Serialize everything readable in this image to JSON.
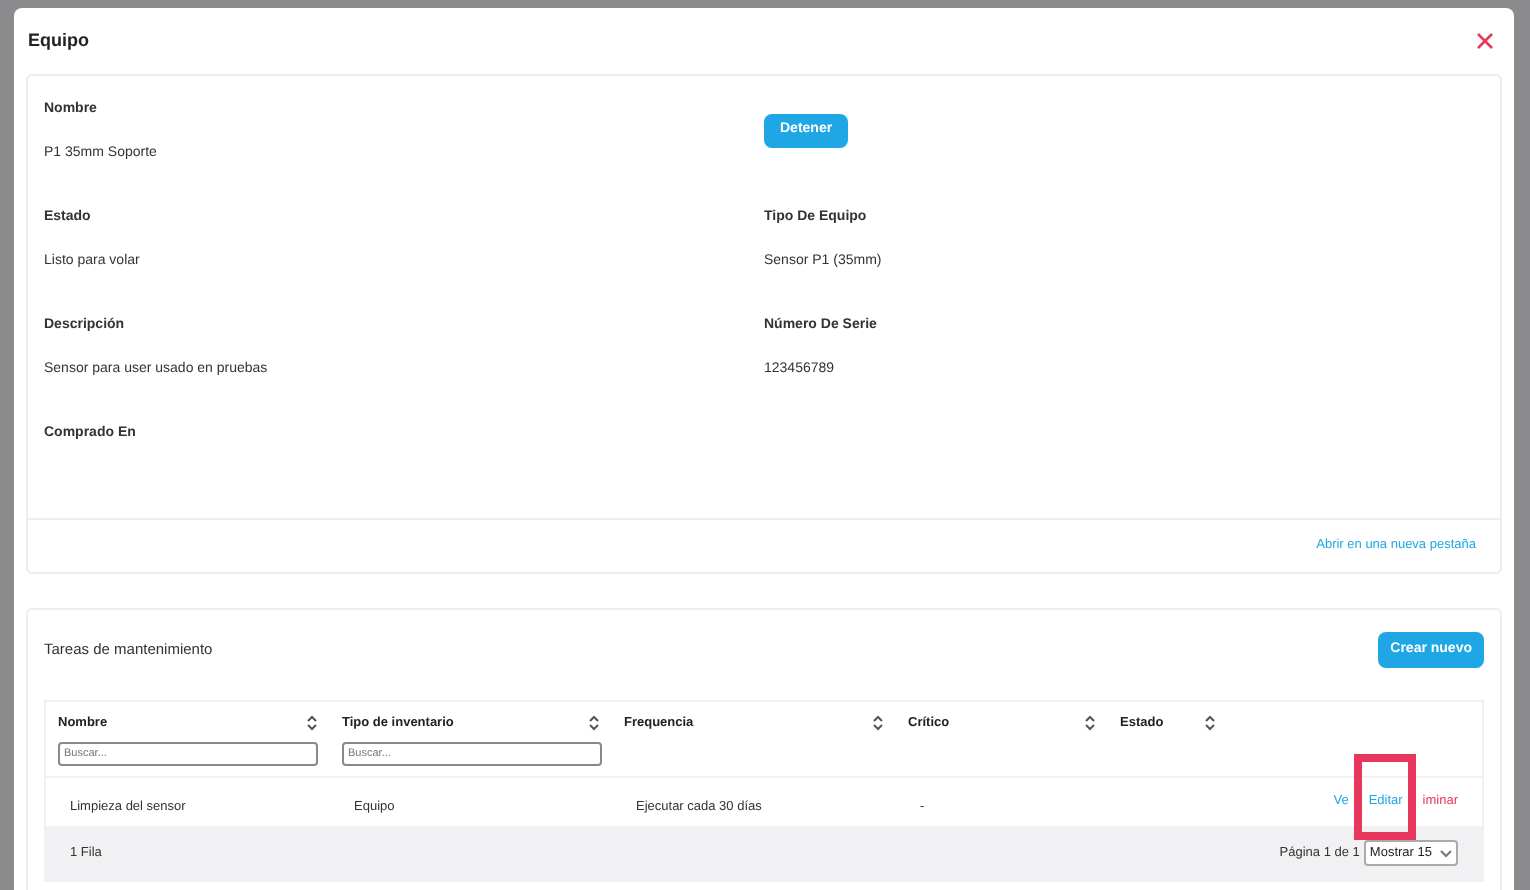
{
  "modal": {
    "title": "Equipo"
  },
  "details": {
    "rows": [
      {
        "cells": [
          {
            "kind": "field",
            "label": "Nombre",
            "value": "P1 35mm Soporte"
          },
          {
            "kind": "button",
            "label": "Detener"
          }
        ]
      },
      {
        "cells": [
          {
            "kind": "field",
            "label": "Estado",
            "value": "Listo para volar"
          },
          {
            "kind": "field",
            "label": "Tipo De Equipo",
            "value": "Sensor P1 (35mm)"
          }
        ]
      },
      {
        "cells": [
          {
            "kind": "field",
            "label": "Descripción",
            "value": "Sensor para user usado en pruebas"
          },
          {
            "kind": "field",
            "label": "Número De Serie",
            "value": "123456789"
          }
        ]
      },
      {
        "cells": [
          {
            "kind": "field",
            "label": "Comprado En"
          }
        ]
      }
    ],
    "link": "Abrir en una nueva pestaña"
  },
  "maintenance": {
    "title": "Tareas de mantenimiento",
    "create_button": "Crear nuevo",
    "columns": [
      {
        "label": "Nombre",
        "search_placeholder": "Buscar..."
      },
      {
        "label": "Tipo de inventario",
        "search_placeholder": "Buscar..."
      },
      {
        "label": "Frequencia"
      },
      {
        "label": "Crítico"
      },
      {
        "label": "Estado"
      }
    ],
    "rows": [
      {
        "cells": [
          "Limpieza del sensor",
          "Equipo",
          "Ejecutar cada 30 días",
          "-",
          ""
        ],
        "actions": [
          {
            "label": "Ve",
            "kind": "link",
            "highlighted": false
          },
          {
            "label": "Editar",
            "kind": "link",
            "highlighted": true
          },
          {
            "label": "iminar",
            "kind": "danger",
            "highlighted": false
          }
        ]
      }
    ],
    "footer": {
      "count": "1 Fila",
      "page": "Página 1 de 1",
      "page_size": "Mostrar 15"
    }
  }
}
